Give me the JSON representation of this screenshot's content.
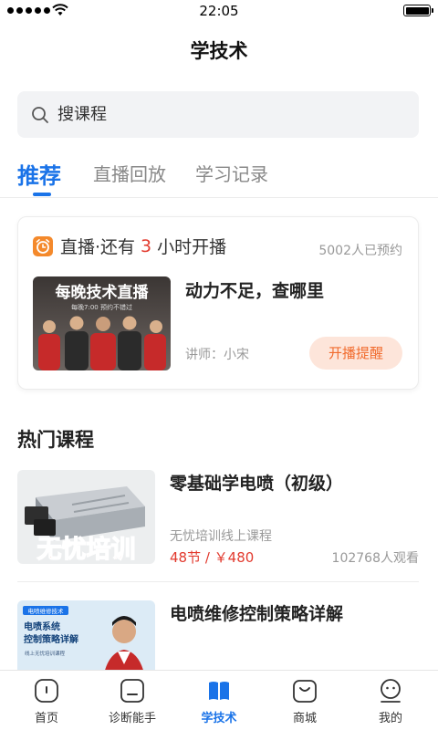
{
  "status_bar": {
    "time": "22:05"
  },
  "header": {
    "title": "学技术"
  },
  "search": {
    "placeholder": "搜课程"
  },
  "tabs": [
    {
      "label": "推荐",
      "active": true
    },
    {
      "label": "直播回放",
      "active": false
    },
    {
      "label": "学习记录",
      "active": false
    }
  ],
  "live": {
    "prefix": "直播·还有",
    "hours": "3",
    "suffix": "小时开播",
    "reserved": "5002人已预约",
    "thumb_title": "每晚技术直播",
    "thumb_sub": "每晚7:00  预约不错过",
    "course_name": "动力不足，查哪里",
    "teacher": "讲师：小宋",
    "remind_label": "开播提醒",
    "accent": "#f16b2d"
  },
  "hot": {
    "title": "热门课程",
    "courses": [
      {
        "title": "零基础学电喷（初级）",
        "subtitle": "无忧培训线上课程",
        "price": "48节 / ￥480",
        "views": "102768人观看",
        "thumb_text": "无忧培训"
      },
      {
        "title": "电喷维修控制策略详解",
        "thumb_tag": "电喷维修技术",
        "thumb_line1": "电喷系统",
        "thumb_line2": "控制策略详解",
        "thumb_small": "线上无忧培训课程"
      }
    ]
  },
  "tabbar": [
    {
      "label": "首页",
      "icon": "home-icon"
    },
    {
      "label": "诊断能手",
      "icon": "diagnosis-icon"
    },
    {
      "label": "学技术",
      "icon": "book-icon",
      "active": true
    },
    {
      "label": "商城",
      "icon": "shop-icon"
    },
    {
      "label": "我的",
      "icon": "profile-icon"
    }
  ],
  "colors": {
    "primary": "#1a73e8",
    "price": "#e23a2e",
    "remind_bg": "#fde5da"
  }
}
